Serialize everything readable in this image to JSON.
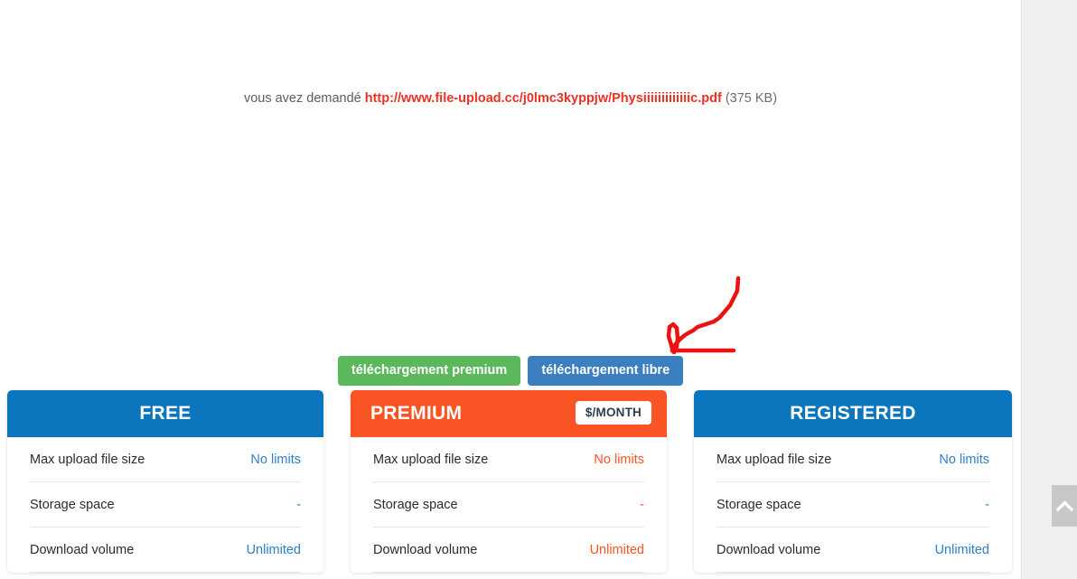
{
  "request": {
    "label": "vous avez demandé ",
    "url": "http://www.file-upload.cc/j0lmc3kyppjw/Physiiiiiiiiiiiiic.pdf",
    "size": " (375 KB)"
  },
  "download_buttons": {
    "premium_label": "téléchargement premium",
    "free_label": "téléchargement libre"
  },
  "colors": {
    "blue": "#0b75bd",
    "orange": "#fb5424",
    "green_button": "#5cb85c",
    "blue_button": "#3b7fbf",
    "link_red": "#ef3124",
    "value_blue": "#2a7fc9",
    "rail_gray": "#f0f0f0",
    "annotation_red": "#ee1111"
  },
  "annotation": {
    "type": "hand-drawn-arrow",
    "color": "#ee1111",
    "points_to": "téléchargement libre"
  },
  "cards": [
    {
      "id": "free",
      "title": "FREE",
      "badge": null,
      "features": [
        {
          "label": "Max upload file size",
          "value": "No limits"
        },
        {
          "label": "Storage space",
          "value": "-"
        },
        {
          "label": "Download volume",
          "value": "Unlimited"
        }
      ]
    },
    {
      "id": "premium",
      "title": "PREMIUM",
      "badge": "$/MONTH",
      "features": [
        {
          "label": "Max upload file size",
          "value": "No limits"
        },
        {
          "label": "Storage space",
          "value": "-"
        },
        {
          "label": "Download volume",
          "value": "Unlimited"
        }
      ]
    },
    {
      "id": "registered",
      "title": "REGISTERED",
      "badge": null,
      "features": [
        {
          "label": "Max upload file size",
          "value": "No limits"
        },
        {
          "label": "Storage space",
          "value": "-"
        },
        {
          "label": "Download volume",
          "value": "Unlimited"
        }
      ]
    }
  ],
  "right_rail": {
    "scroll_top_icon": "chevron-up-icon"
  }
}
